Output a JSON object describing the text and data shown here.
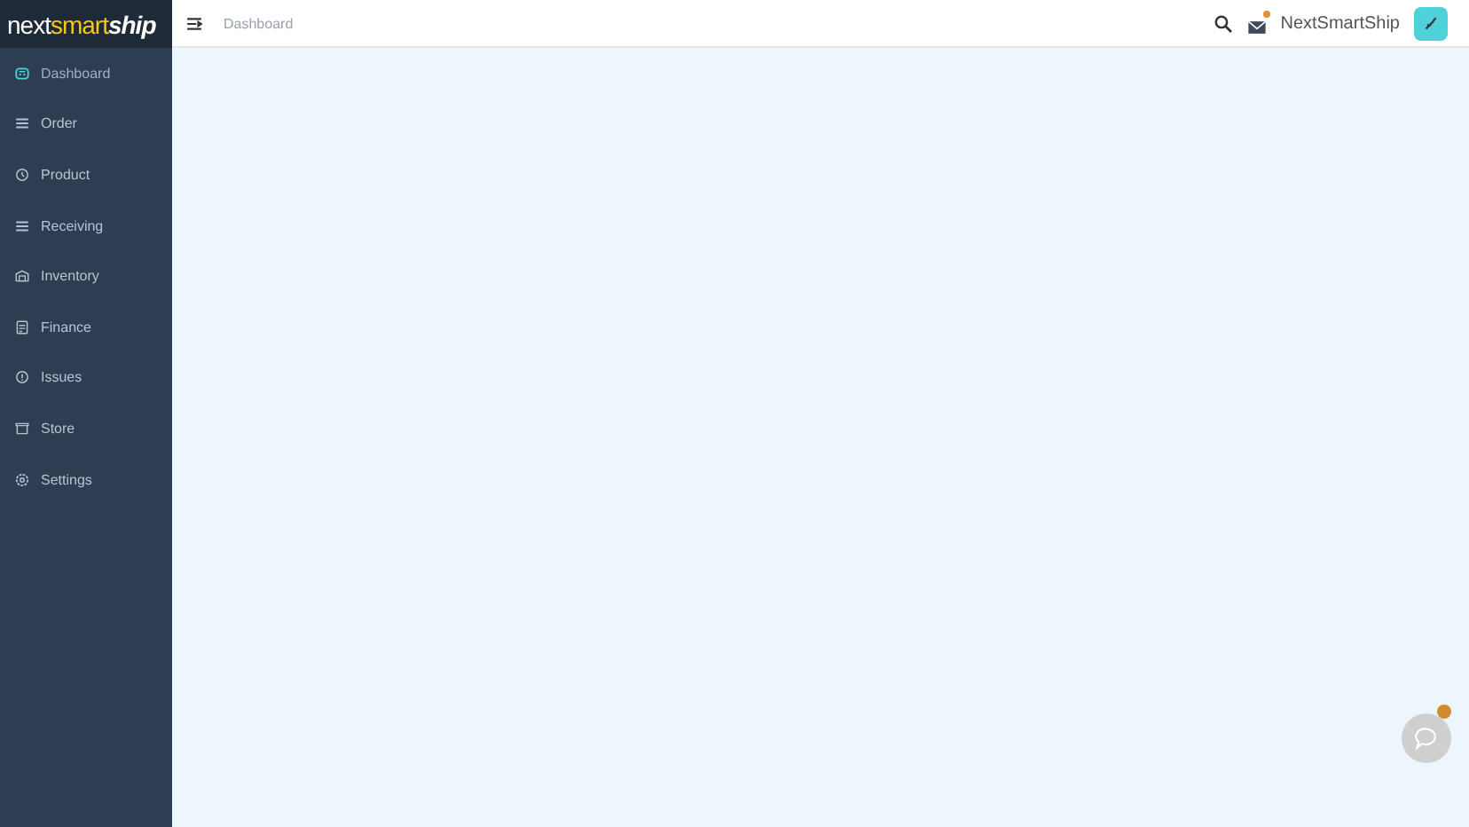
{
  "logo": {
    "parts": [
      "next",
      "smart",
      "ship"
    ]
  },
  "sidebar": {
    "items": [
      {
        "label": "Dashboard",
        "selected": true
      },
      {
        "label": "Order",
        "selected": false
      },
      {
        "label": "Product",
        "selected": false
      },
      {
        "label": "Receiving",
        "selected": false
      },
      {
        "label": "Inventory",
        "selected": false
      },
      {
        "label": "Finance",
        "selected": false
      },
      {
        "label": "Issues",
        "selected": false
      },
      {
        "label": "Store",
        "selected": false
      },
      {
        "label": "Settings",
        "selected": false
      }
    ]
  },
  "topbar": {
    "breadcrumb": "Dashboard",
    "user": "NextSmartShip",
    "unread_mail": true
  },
  "chat": {
    "unread": true
  }
}
